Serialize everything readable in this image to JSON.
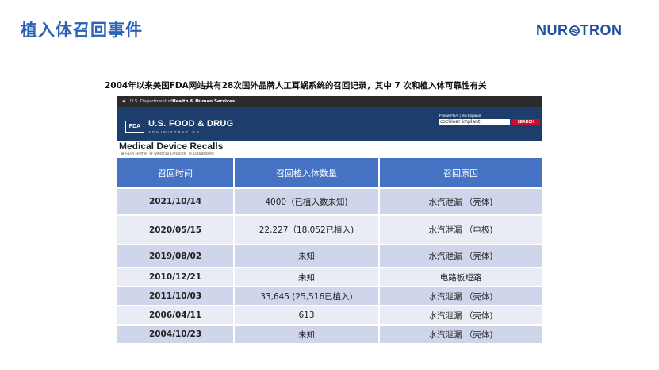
{
  "slide": {
    "title": "植入体召回事件",
    "logo_pre": "NUR",
    "logo_post": "TRON",
    "subtitle": "2004年以来美国FDA网站共有28次国外品牌人工耳蜗系统的召回记录，其中 7 次和植入体可靠性有关"
  },
  "fda": {
    "hhs_text_prefix": "U.S. Department of ",
    "hhs_text_bold": "Health & Human Services",
    "name": "U.S. FOOD & DRUG",
    "admin": "ADMINISTRATION",
    "logo_box": "FDA",
    "follow_links": "Follow FDA  |  En Español",
    "search_value": "cochlear implant",
    "search_button": "SEARCH",
    "page_title": "Medical Device Recalls",
    "breadcrumb": "⊕ FDA Home  ⊕ Medical Devices  ⊕ Databases"
  },
  "table": {
    "headers": [
      "召回时间",
      "召回植入体数量",
      "召回原因"
    ],
    "rows": [
      [
        "2021/10/14",
        "4000（已植入数未知)",
        "水汽泄漏  （壳体)"
      ],
      [
        "2020/05/15",
        "22,227（18,052已植入)",
        "水汽泄漏  （电极)"
      ],
      [
        "2019/08/02",
        "未知",
        "水汽泄漏  （壳体)"
      ],
      [
        "2010/12/21",
        "未知",
        "电路板短路"
      ],
      [
        "2011/10/03",
        "33,645 (25,516已植入)",
        "水汽泄漏  （壳体)"
      ],
      [
        "2006/04/11",
        "613",
        "水汽泄漏  （壳体)"
      ],
      [
        "2004/10/23",
        "未知",
        "水汽泄漏  （壳体)"
      ]
    ]
  }
}
